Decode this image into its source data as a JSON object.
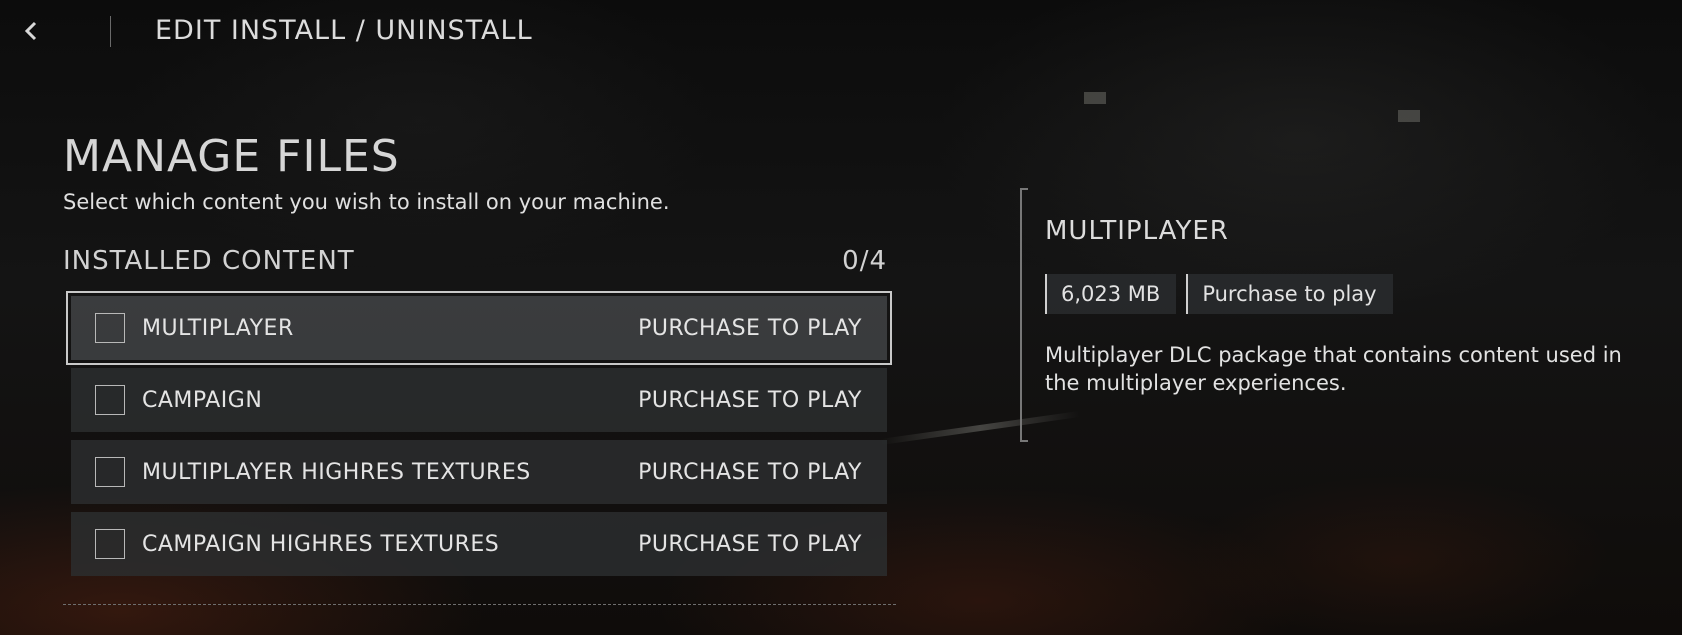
{
  "header": {
    "title": "EDIT INSTALL / UNINSTALL",
    "back_icon": "chevron-left-icon"
  },
  "manage": {
    "title": "MANAGE FILES",
    "subtitle": "Select which content you wish to install on your machine."
  },
  "installed": {
    "title": "INSTALLED CONTENT",
    "count": "0/4",
    "items": [
      {
        "label": "MULTIPLAYER",
        "status": "PURCHASE TO PLAY",
        "checked": false,
        "selected": true
      },
      {
        "label": "CAMPAIGN",
        "status": "PURCHASE TO PLAY",
        "checked": false,
        "selected": false
      },
      {
        "label": "MULTIPLAYER HIGHRES TEXTURES",
        "status": "PURCHASE TO PLAY",
        "checked": false,
        "selected": false
      },
      {
        "label": "CAMPAIGN HIGHRES TEXTURES",
        "status": "PURCHASE TO PLAY",
        "checked": false,
        "selected": false
      }
    ]
  },
  "detail": {
    "title": "MULTIPLAYER",
    "size": "6,023 MB",
    "status": "Purchase to play",
    "description": "Multiplayer DLC package that contains content used in the multiplayer experiences."
  },
  "colors": {
    "text": "#e4e4e4",
    "row_bg": "#2c2e30",
    "selected_outline": "#c9c9c9"
  }
}
